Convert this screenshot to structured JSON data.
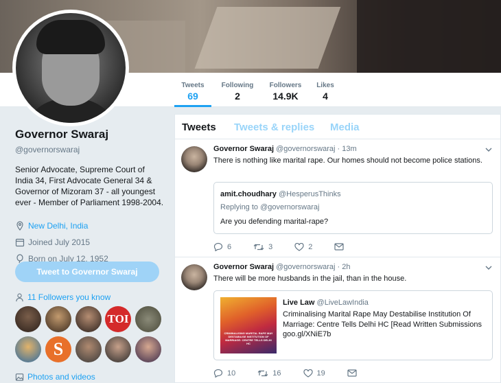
{
  "nav": {
    "tweets_label": "Tweets",
    "tweets_value": "69",
    "following_label": "Following",
    "following_value": "2",
    "followers_label": "Followers",
    "followers_value": "14.9K",
    "likes_label": "Likes",
    "likes_value": "4"
  },
  "profile": {
    "name": "Governor Swaraj",
    "handle": "@governorswaraj",
    "bio": "Senior Advocate, Supreme Court of India 34, First Advocate General 34 & Governor of Mizoram 37 - all youngest ever - Member of Parliament 1998-2004.",
    "location": "New Delhi, India",
    "joined": "Joined July 2015",
    "born": "Born on July 12, 1952",
    "tweet_to_button": "Tweet to Governor Swaraj",
    "followers_you_know": "11 Followers you know",
    "photos_label": "Photos and videos"
  },
  "tabs": {
    "tweets": "Tweets",
    "replies": "Tweets & replies",
    "media": "Media"
  },
  "tweets": [
    {
      "name": "Governor Swaraj",
      "handle": "@governorswaraj",
      "time": "· 13m",
      "text": "There is nothing like marital rape. Our homes should not become police stations.",
      "quote": {
        "name": "amit.choudhary",
        "handle": "@HesperusThinks",
        "replying": "Replying to @governorswaraj",
        "text": "Are you defending marital-rape?"
      },
      "replies": "6",
      "retweets": "3",
      "likes": "2"
    },
    {
      "name": "Governor Swaraj",
      "handle": "@governorswaraj",
      "time": "· 2h",
      "text": "There will be more husbands in the jail, than in the house.",
      "card": {
        "name": "Live Law",
        "handle": "@LiveLawIndia",
        "text": "Criminalising Marital Rape May Destabilise Institution Of Marriage: Centre Tells Delhi HC [Read Written Submissions goo.gl/XNiE7b",
        "image_text": "CRIMINALISING MARITAL RAPE MAY DESTABILISE INSTITUTION OF MARRIAGE: CENTRE TELLS DELHI HC"
      },
      "replies": "10",
      "retweets": "16",
      "likes": "19"
    }
  ],
  "colors": {
    "accent": "#1da1f2",
    "muted": "#657786",
    "like": "#e0245e",
    "retweet": "#17bf63"
  }
}
